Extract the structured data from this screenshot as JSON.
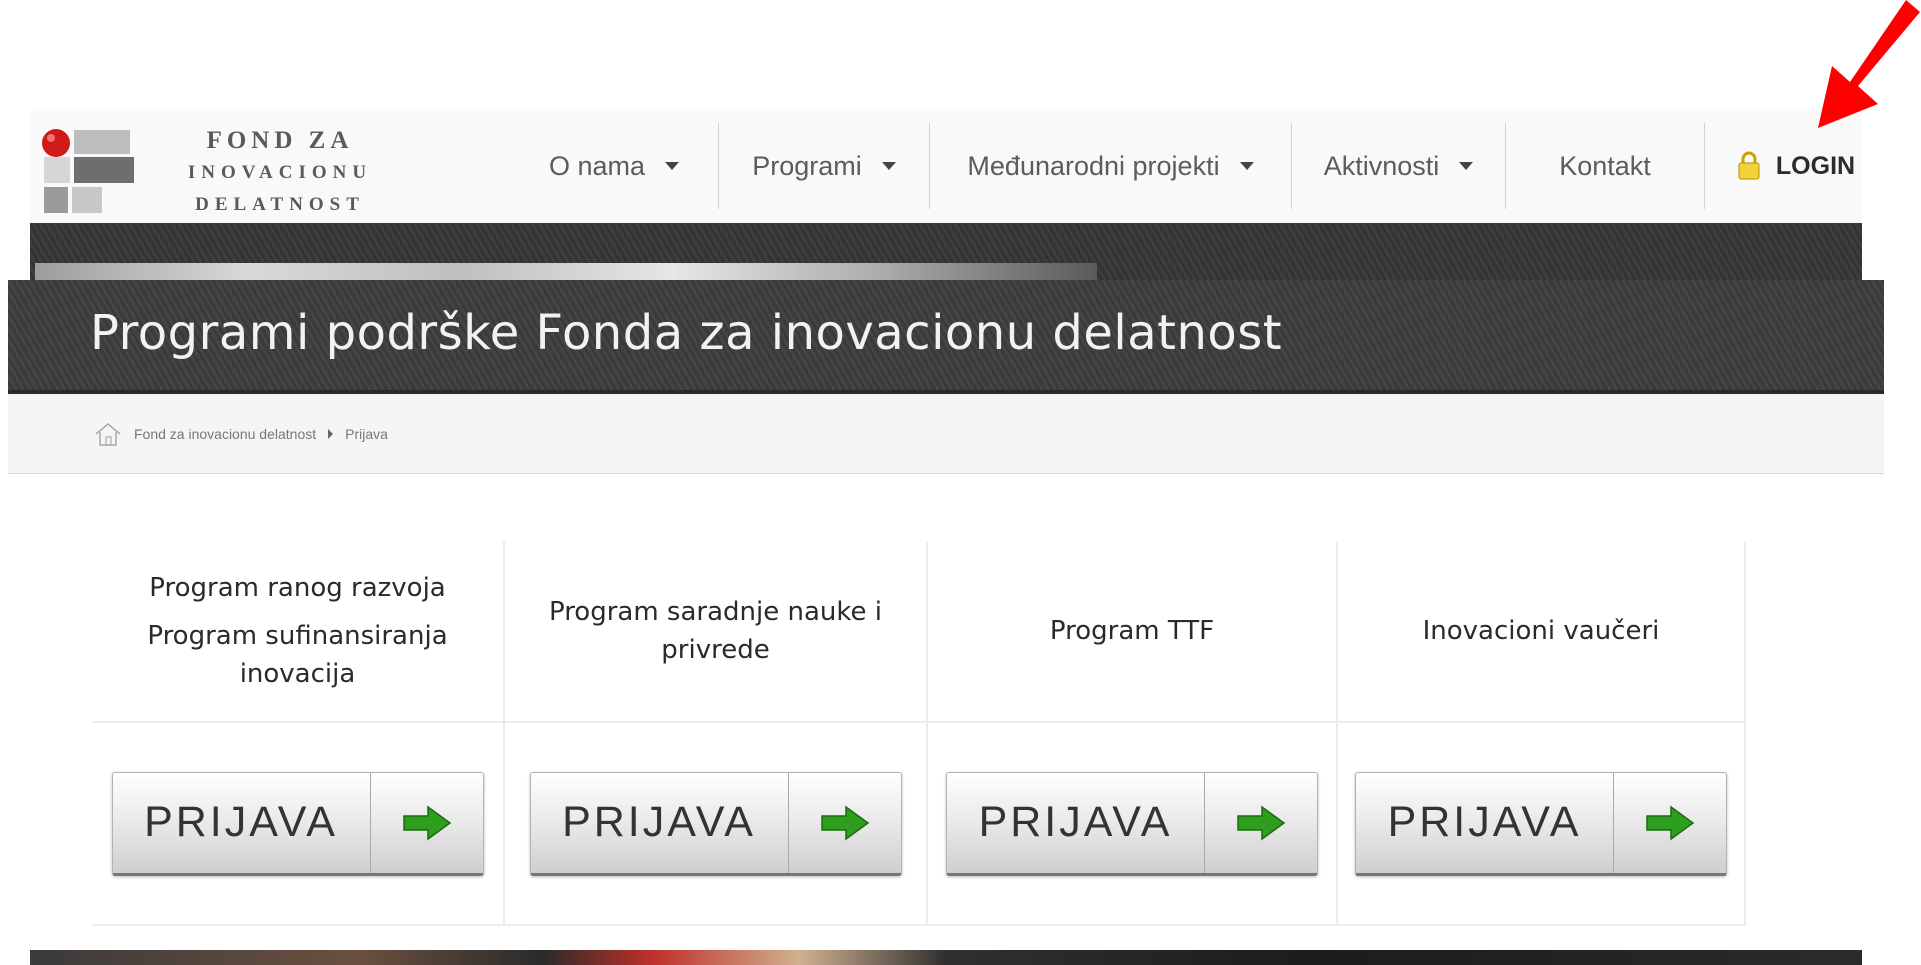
{
  "header": {
    "logo_lines": [
      "Fond za",
      "inovacionu",
      "delatnost"
    ],
    "nav": [
      {
        "label": "O nama",
        "dropdown": true,
        "icon": "caret-down-icon"
      },
      {
        "label": "Programi",
        "dropdown": true,
        "icon": "caret-down-icon"
      },
      {
        "label": "Međunarodni projekti",
        "dropdown": true,
        "icon": "caret-down-icon"
      },
      {
        "label": "Aktivnosti",
        "dropdown": true,
        "icon": "caret-down-icon"
      },
      {
        "label": "Kontakt",
        "dropdown": false
      },
      {
        "label": "LOGIN",
        "icon": "lock-icon"
      }
    ],
    "annotation_icon": "red-arrow-pointer-icon"
  },
  "page_title": "Programi podrške Fonda za inovacionu delatnost",
  "breadcrumb": {
    "icon": "home-icon",
    "items": [
      "Fond za inovacionu delatnost",
      "Prijava"
    ]
  },
  "programs": [
    {
      "names": [
        "Program ranog razvoja",
        "Program sufinansiranja inovacija"
      ],
      "button": "PRIJAVA",
      "button_icon": "arrow-right-icon"
    },
    {
      "names": [
        "Program saradnje nauke i privrede"
      ],
      "button": "PRIJAVA",
      "button_icon": "arrow-right-icon"
    },
    {
      "names": [
        "Program TTF"
      ],
      "button": "PRIJAVA",
      "button_icon": "arrow-right-icon"
    },
    {
      "names": [
        "Inovacioni vaučeri"
      ],
      "button": "PRIJAVA",
      "button_icon": "arrow-right-icon"
    }
  ],
  "colors": {
    "accent_arrow": "#2e9e1e",
    "annotation_arrow": "#ff0000",
    "title_bar": "#3d3d3d",
    "title_text": "#f2f2f2"
  }
}
